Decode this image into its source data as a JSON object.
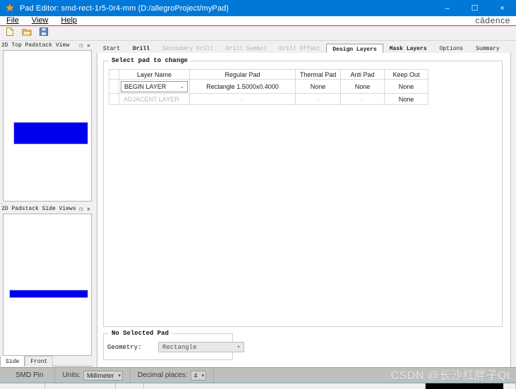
{
  "window": {
    "title": "Pad Editor: smd-rect-1r5-0r4-mm  (D:/allegroProject/myPad)",
    "app_icon": "pad-editor-icon",
    "minimize": "–",
    "maximize": "☐",
    "close": "×"
  },
  "brand": {
    "logo_text": "cādence"
  },
  "menubar": {
    "items": [
      {
        "label": "File",
        "mnemonic": "F"
      },
      {
        "label": "View",
        "mnemonic": "V"
      },
      {
        "label": "Help",
        "mnemonic": "H"
      }
    ]
  },
  "toolbar": {
    "buttons": [
      {
        "name": "new-file-button",
        "icon": "new-document-icon",
        "tooltip": "New"
      },
      {
        "name": "open-file-button",
        "icon": "open-folder-icon",
        "tooltip": "Open"
      },
      {
        "name": "save-file-button",
        "icon": "floppy-disk-icon",
        "tooltip": "Save"
      }
    ]
  },
  "docks": [
    {
      "name": "top-padstack-view",
      "title": "2D Top Padstack View",
      "float_glyph": "❐",
      "close_glyph": "✕"
    },
    {
      "name": "padstack-side-views",
      "title": "2D Padstack Side Views",
      "float_glyph": "❐",
      "close_glyph": "✕"
    }
  ],
  "view_tabs": {
    "items": [
      {
        "label": "Side",
        "active": true
      },
      {
        "label": "Front",
        "active": false
      }
    ]
  },
  "tabs": [
    {
      "label": "Start",
      "state": "normal"
    },
    {
      "label": "Drill",
      "state": "bold"
    },
    {
      "label": "Secondary Drill",
      "state": "disabled"
    },
    {
      "label": "Drill Symbol",
      "state": "disabled"
    },
    {
      "label": "Drill Offset",
      "state": "disabled"
    },
    {
      "label": "Design Layers",
      "state": "active"
    },
    {
      "label": "Mask Layers",
      "state": "bold"
    },
    {
      "label": "Options",
      "state": "normal"
    },
    {
      "label": "Summary",
      "state": "normal"
    }
  ],
  "select_pad_group": {
    "title": "Select pad to change",
    "table": {
      "headers": [
        "",
        "Layer Name",
        "Regular Pad",
        "Thermal Pad",
        "Anti Pad",
        "Keep Out"
      ],
      "rows": [
        {
          "kind": "combo",
          "handle": "",
          "layer_name": "BEGIN LAYER",
          "layer_arrow": "⌄",
          "regular_pad": "Rectangle 1.5000x0.4000",
          "thermal_pad": "None",
          "anti_pad": "None",
          "keep_out": "None"
        },
        {
          "kind": "static",
          "handle": "",
          "layer_name": "ADJACENT LAYER",
          "regular_pad": "-",
          "thermal_pad": "-",
          "anti_pad": "-",
          "keep_out": "None"
        }
      ]
    }
  },
  "no_selected_pad_group": {
    "title": "No Selected Pad",
    "geometry_label": "Geometry:",
    "geometry_value": "Rectangle",
    "geometry_arrow": "▾"
  },
  "statusbar": {
    "pin_type": "SMD Pin",
    "units_label": "Units:",
    "units_value": "Millimeter",
    "units_arrow": "▾",
    "decimals_label": "Decimal places:",
    "decimals_value": "4",
    "decimals_arrow": "▾"
  },
  "watermark": {
    "text": "CSDN @长沙红胖子Qt"
  },
  "colors": {
    "titlebar": "#0078d7",
    "pad_blue": "#0000ee",
    "menu_underline": "#ff2222",
    "status_bg": "#bfbfbf"
  }
}
